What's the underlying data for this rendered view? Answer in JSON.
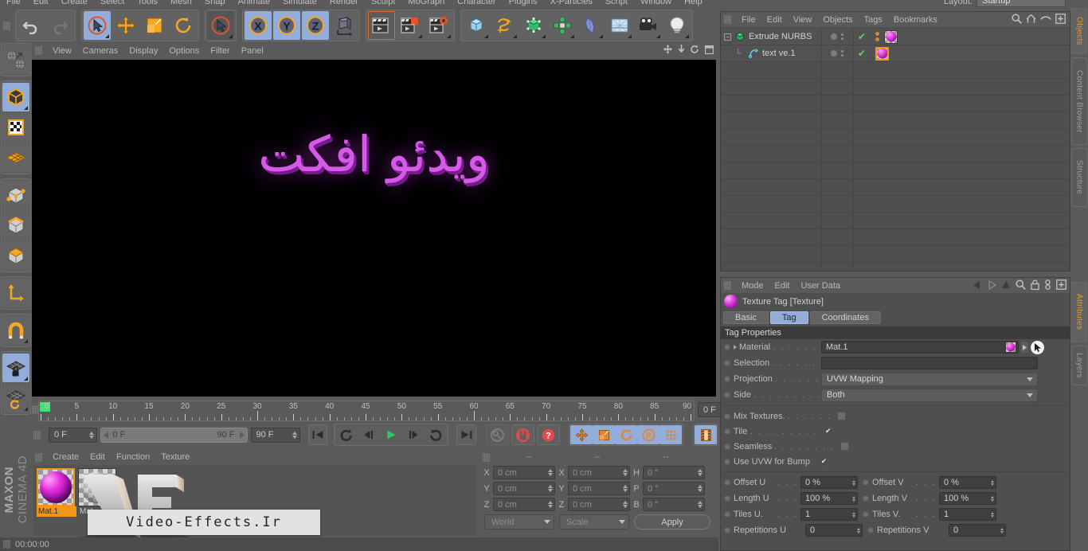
{
  "app": {
    "name": "CINEMA 4D",
    "vendor": "MAXON",
    "status_time": "00:00:00"
  },
  "menubar": {
    "items": [
      "File",
      "Edit",
      "Create",
      "Select",
      "Tools",
      "Mesh",
      "Snap",
      "Animate",
      "Simulate",
      "Render",
      "Sculpt",
      "MoGraph",
      "Character",
      "Plugins",
      "X-Particles",
      "Script",
      "Window",
      "Help"
    ],
    "layout_label": "Layout:",
    "layout_value": "Startup"
  },
  "toolbar": {
    "groups": [
      {
        "name": "undo-redo",
        "buttons": [
          {
            "name": "undo-button",
            "icon": "undo-icon",
            "state": "normal"
          },
          {
            "name": "redo-button",
            "icon": "redo-icon",
            "state": "disabled"
          }
        ]
      },
      {
        "name": "transform-tools",
        "buttons": [
          {
            "name": "live-selection-button",
            "icon": "live-selection-icon",
            "state": "selected"
          },
          {
            "name": "move-button",
            "icon": "move-icon",
            "state": "normal"
          },
          {
            "name": "scale-button",
            "icon": "scale-icon",
            "state": "normal"
          },
          {
            "name": "rotate-button",
            "icon": "rotate-icon",
            "state": "normal"
          }
        ]
      },
      {
        "name": "selection-tool",
        "buttons": [
          {
            "name": "selection-mode-button",
            "icon": "cursor-circle-icon",
            "state": "dark"
          }
        ]
      },
      {
        "name": "axis-locks",
        "buttons": [
          {
            "name": "lock-x-button",
            "icon": "axis-x-icon",
            "state": "selected"
          },
          {
            "name": "lock-y-button",
            "icon": "axis-y-icon",
            "state": "selected"
          },
          {
            "name": "lock-z-button",
            "icon": "axis-z-icon",
            "state": "selected"
          },
          {
            "name": "world-object-coord-button",
            "icon": "world-axis-icon",
            "state": "normal"
          }
        ]
      },
      {
        "name": "render-tools",
        "buttons": [
          {
            "name": "render-view-button",
            "icon": "render-view-icon",
            "state": "active"
          },
          {
            "name": "render-region-button",
            "icon": "render-region-icon",
            "state": "normal"
          },
          {
            "name": "render-settings-button",
            "icon": "render-settings-icon",
            "state": "normal"
          }
        ]
      },
      {
        "name": "create-objects",
        "buttons": [
          {
            "name": "add-cube-button",
            "icon": "cube-icon",
            "state": "normal"
          },
          {
            "name": "add-spline-button",
            "icon": "spline-icon",
            "state": "normal"
          },
          {
            "name": "add-nurbs-button",
            "icon": "nurbs-icon",
            "state": "normal"
          },
          {
            "name": "add-array-button",
            "icon": "array-icon",
            "state": "normal"
          },
          {
            "name": "add-deformer-button",
            "icon": "bend-deformer-icon",
            "state": "normal"
          },
          {
            "name": "add-environment-button",
            "icon": "floor-icon",
            "state": "normal"
          },
          {
            "name": "add-camera-button",
            "icon": "camera-icon",
            "state": "normal"
          },
          {
            "name": "add-light-button",
            "icon": "light-bulb-icon",
            "state": "normal"
          }
        ]
      }
    ]
  },
  "left_toolbar": {
    "groups": [
      {
        "buttons": [
          {
            "name": "viewport-mode-button",
            "icon": "globe-arrow-icon",
            "state": "normal"
          }
        ]
      },
      {
        "buttons": [
          {
            "name": "model-mode-button",
            "icon": "model-cube-icon",
            "state": "selected"
          },
          {
            "name": "texture-mode-button",
            "icon": "texture-checker-icon",
            "state": "normal"
          },
          {
            "name": "uv-mesh-mode-button",
            "icon": "uv-mesh-icon",
            "state": "normal"
          }
        ]
      },
      {
        "buttons": [
          {
            "name": "points-mode-button",
            "icon": "points-cube-icon",
            "state": "normal"
          },
          {
            "name": "edges-mode-button",
            "icon": "edges-cube-icon",
            "state": "normal"
          },
          {
            "name": "polygons-mode-button",
            "icon": "polygons-cube-icon",
            "state": "normal"
          }
        ]
      },
      {
        "buttons": [
          {
            "name": "axis-mode-button",
            "icon": "axis-l-icon",
            "state": "normal"
          }
        ]
      },
      {
        "buttons": [
          {
            "name": "snap-magnet-button",
            "icon": "magnet-icon",
            "state": "normal"
          }
        ]
      },
      {
        "buttons": [
          {
            "name": "workplane-lock-button",
            "icon": "workplane-lock-icon",
            "state": "selected"
          },
          {
            "name": "workplane-rotate-button",
            "icon": "workplane-rotate-icon",
            "state": "normal"
          }
        ]
      }
    ]
  },
  "viewport": {
    "menu": [
      "View",
      "Cameras",
      "Display",
      "Options",
      "Filter",
      "Panel"
    ],
    "icons": [
      "move-viewport-icon",
      "zoom-viewport-icon",
      "rotate-viewport-icon",
      "maximize-viewport-icon"
    ],
    "scene_text": "ویدئو افکت",
    "text_color": "#d65ae8",
    "background": "#000000"
  },
  "timeline": {
    "tick_labels": [
      "0",
      "5",
      "10",
      "15",
      "20",
      "25",
      "30",
      "35",
      "40",
      "45",
      "50",
      "55",
      "60",
      "65",
      "70",
      "75",
      "80",
      "85",
      "90"
    ],
    "min_frame": 0,
    "max_frame": 90,
    "current_frame_field": "0 F",
    "range_start": "0 F",
    "range_end": "90 F",
    "end_frame_field": "90 F",
    "current_frame_right": "0 F",
    "transport": [
      {
        "name": "go-to-start-button",
        "icon": "skip-start-icon"
      },
      {
        "name": "previous-key-button",
        "icon": "prev-key-icon"
      },
      {
        "name": "step-back-button",
        "icon": "step-back-icon"
      },
      {
        "name": "play-button",
        "icon": "play-icon"
      },
      {
        "name": "step-forward-button",
        "icon": "step-forward-icon"
      },
      {
        "name": "next-key-button",
        "icon": "next-key-icon"
      },
      {
        "name": "go-to-end-button",
        "icon": "skip-end-icon"
      }
    ],
    "record_tools": [
      {
        "name": "record-key-button",
        "icon": "key-icon",
        "state": "disabled"
      },
      {
        "name": "autokeying-button",
        "icon": "autokey-icon",
        "state": "red"
      },
      {
        "name": "keyframe-selection-button",
        "icon": "question-icon",
        "state": "red"
      }
    ],
    "key_toggles": [
      {
        "name": "key-position-button",
        "icon": "position-icon",
        "state": "selected"
      },
      {
        "name": "key-scale-button",
        "icon": "scale-key-icon",
        "state": "selected"
      },
      {
        "name": "key-rotation-button",
        "icon": "rotation-key-icon",
        "state": "selected"
      },
      {
        "name": "key-param-button",
        "icon": "param-p-icon",
        "state": "selected"
      },
      {
        "name": "key-pla-button",
        "icon": "pla-dots-icon",
        "state": "selected"
      }
    ],
    "extra": [
      {
        "name": "timeline-filmstrip-button",
        "icon": "filmstrip-icon",
        "state": "selected"
      }
    ]
  },
  "material_manager": {
    "menu": [
      "Create",
      "Edit",
      "Function",
      "Texture"
    ],
    "materials": [
      {
        "name": "Mat.1",
        "selected": true,
        "type": "magenta-sphere"
      },
      {
        "name": "Mat",
        "selected": false,
        "type": "glass-sphere"
      }
    ]
  },
  "coordinates": {
    "headers": [
      "--",
      "--",
      "--"
    ],
    "rows": [
      {
        "label_a": "X",
        "value_a": "0 cm",
        "label_b": "X",
        "value_b": "0 cm",
        "label_c": "H",
        "value_c": "0 °"
      },
      {
        "label_a": "Y",
        "value_a": "0 cm",
        "label_b": "Y",
        "value_b": "0 cm",
        "label_c": "P",
        "value_c": "0 °"
      },
      {
        "label_a": "Z",
        "value_a": "0 cm",
        "label_b": "Z",
        "value_b": "0 cm",
        "label_c": "B",
        "value_c": "0 °"
      }
    ],
    "system_select": "World",
    "mode_select": "Scale",
    "apply_label": "Apply"
  },
  "object_manager": {
    "menu": [
      "File",
      "Edit",
      "View",
      "Objects",
      "Tags",
      "Bookmarks"
    ],
    "icons": [
      "search-icon",
      "home-icon",
      "eye-icon",
      "plus-box-icon"
    ],
    "objects": [
      {
        "name": "Extrude NURBS",
        "icon": "extrude-nurbs-icon",
        "indent": 0,
        "expanded": true,
        "tag_selected": false
      },
      {
        "name": "text ve.1",
        "icon": "text-spline-icon",
        "indent": 1,
        "expanded": false,
        "tag_selected": true
      }
    ]
  },
  "attributes": {
    "menu": [
      "Mode",
      "Edit",
      "User Data"
    ],
    "icons": [
      "back-arrow-icon",
      "forward-arrow-icon",
      "up-arrow-icon",
      "search-icon",
      "lock-icon",
      "link-icon",
      "plus-box-icon"
    ],
    "title": "Texture Tag [Texture]",
    "tabs": [
      {
        "label": "Basic",
        "selected": false
      },
      {
        "label": "Tag",
        "selected": true
      },
      {
        "label": "Coordinates",
        "selected": false
      }
    ],
    "section_title": "Tag Properties",
    "fields": [
      {
        "name": "material-field",
        "label": "Material",
        "dots": ". . . . . . .",
        "value": "Mat.1",
        "type": "material-link"
      },
      {
        "name": "selection-field",
        "label": "Selection",
        "dots": ". . . . . . . .",
        "value": "",
        "type": "text"
      },
      {
        "name": "projection-select",
        "label": "Projection",
        "dots": ". . . . . . .",
        "value": "UVW Mapping",
        "type": "select"
      },
      {
        "name": "side-select",
        "label": "Side",
        "dots": ". . . . . . . . . . . .",
        "value": "Both",
        "type": "select"
      }
    ],
    "checkboxes": [
      {
        "name": "mix-textures-checkbox",
        "label": "Mix Textures.",
        "dots": ". . . . . .",
        "checked": false
      },
      {
        "name": "tile-checkbox",
        "label": "Tile",
        "dots": ". . . . . . . . . . . . .",
        "checked": true
      },
      {
        "name": "seamless-checkbox",
        "label": "Seamless",
        "dots": ". . . . . . . .",
        "checked": false
      },
      {
        "name": "use-uvw-bump-checkbox",
        "label": "Use UVW for Bump",
        "dots": "",
        "checked": true
      }
    ],
    "numeric_pairs": [
      {
        "left_name": "offset-u-field",
        "left_label": "Offset U",
        "left_dots": ". . . .",
        "left_value": "0 %",
        "right_name": "offset-v-field",
        "right_label": "Offset V",
        "right_dots": ". . . .",
        "right_value": "0 %"
      },
      {
        "left_name": "length-u-field",
        "left_label": "Length U",
        "left_dots": ". . .",
        "left_value": "100 %",
        "right_name": "length-v-field",
        "right_label": "Length V",
        "right_dots": ". . .",
        "right_value": "100 %"
      },
      {
        "left_name": "tiles-u-field",
        "left_label": "Tiles U.",
        "left_dots": ". . . . .",
        "left_value": "1",
        "right_name": "tiles-v-field",
        "right_label": "Tiles V.",
        "right_dots": ". . . . .",
        "right_value": "1"
      },
      {
        "left_name": "repetitions-u-field",
        "left_label": "Repetitions U",
        "left_dots": "",
        "left_value": "0",
        "right_name": "repetitions-v-field",
        "right_label": "Repetitions V",
        "right_dots": "",
        "right_value": "0"
      }
    ]
  },
  "vertical_tabs": [
    {
      "label": "Objects",
      "selected": true
    },
    {
      "label": "Content Browser",
      "selected": false
    },
    {
      "label": "Structure",
      "selected": false
    },
    {
      "label": "Attributes",
      "selected": true
    },
    {
      "label": "Layers",
      "selected": false
    }
  ],
  "watermark": {
    "text": "Video-Effects.Ir",
    "logo": "VE"
  },
  "colors": {
    "accent_orange": "#f0971a",
    "selection_blue": "#93adda",
    "panel_bg": "#5a5a5a",
    "magenta": "#d65ae8",
    "green_check": "#57d36b"
  }
}
